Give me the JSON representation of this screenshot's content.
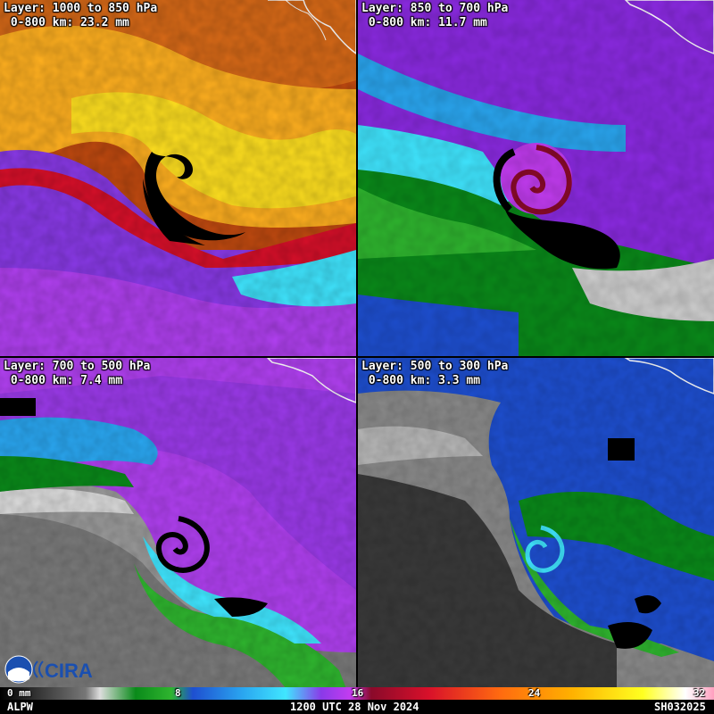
{
  "panels": [
    {
      "layer": "Layer: 1000 to 850 hPa",
      "value": " 0-800 km: 23.2 mm"
    },
    {
      "layer": "Layer: 850 to 700 hPa",
      "value": " 0-800 km: 11.7 mm"
    },
    {
      "layer": "Layer: 700 to 500 hPa",
      "value": " 0-800 km: 7.4 mm"
    },
    {
      "layer": "Layer: 500 to 300 hPa",
      "value": " 0-800 km: 3.3 mm"
    }
  ],
  "colorbar": {
    "ticks": [
      "0 mm",
      "8",
      "16",
      "24",
      "32"
    ],
    "unit": "mm"
  },
  "footer": {
    "product": "ALPW",
    "time": "1200 UTC 28 Nov 2024",
    "id": "SH032025"
  },
  "logo": {
    "text": "CIRA",
    "icon": "noaa-cira-logo-icon"
  },
  "colors": {
    "high": "#ffff20",
    "mid": "#c23cf0",
    "low": "#1e4fd0",
    "dry": "#9a9a9a",
    "missing": "#000000"
  }
}
